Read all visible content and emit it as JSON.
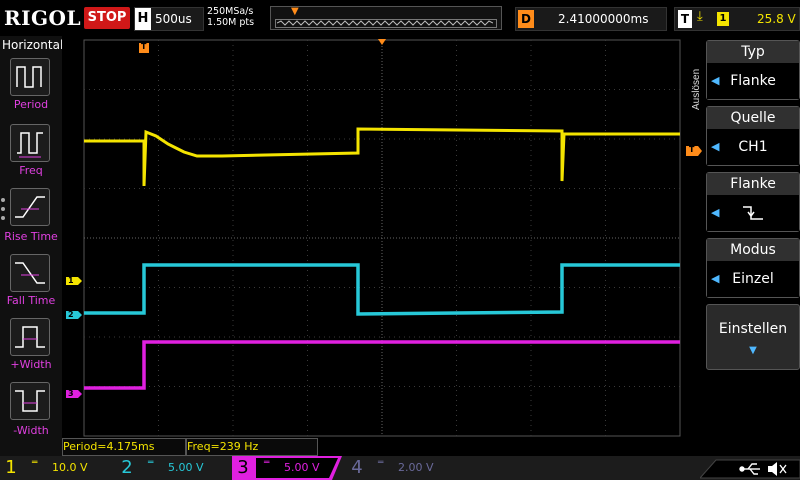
{
  "topbar": {
    "brand": "RIGOL",
    "run_state": "STOP",
    "h_label": "H",
    "timebase": "500us",
    "sample_rate": "250MSa/s",
    "mem_depth": "1.50M pts",
    "d_label": "D",
    "delay": "2.41000000ms",
    "t_label": "T",
    "trigger_channel": "1",
    "trigger_level": "25.8 V"
  },
  "left_panel": {
    "title": "Horizontal",
    "items": [
      {
        "label": "Period"
      },
      {
        "label": "Freq"
      },
      {
        "label": "Rise Time"
      },
      {
        "label": "Fall Time"
      },
      {
        "label": "+Width"
      },
      {
        "label": "-Width"
      }
    ]
  },
  "right_panel": {
    "side_label": "Auslösen",
    "menus": [
      {
        "header": "Typ",
        "value": "Flanke"
      },
      {
        "header": "Quelle",
        "value": "CH1"
      },
      {
        "header": "Flanke",
        "value": "falling-edge-icon"
      },
      {
        "header": "Modus",
        "value": "Einzel"
      },
      {
        "header": "Einstellen",
        "value": ""
      }
    ]
  },
  "measurements": {
    "period": "Period=4.175ms",
    "freq": "Freq=239 Hz"
  },
  "channels": [
    {
      "num": "1",
      "scale": "10.0 V",
      "color": "#f4e400",
      "active": true
    },
    {
      "num": "2",
      "scale": "5.00 V",
      "color": "#27c8d8",
      "active": true
    },
    {
      "num": "3",
      "scale": "5.00 V",
      "color": "#e020e0",
      "active": true
    },
    {
      "num": "4",
      "scale": "2.00 V",
      "color": "#5a7ad0",
      "active": false
    }
  ],
  "markers": {
    "ch1": "1",
    "ch2": "2",
    "ch3": "3",
    "trigger": "T"
  },
  "colors": {
    "ch1": "#f4e400",
    "ch2": "#27c8d8",
    "ch3": "#e020e0",
    "trigger": "#ff8c1a",
    "stop": "#d01818"
  },
  "icons": [
    "usb-icon",
    "speaker-icon",
    "falling-edge-icon",
    "trigger-marker-icon"
  ]
}
